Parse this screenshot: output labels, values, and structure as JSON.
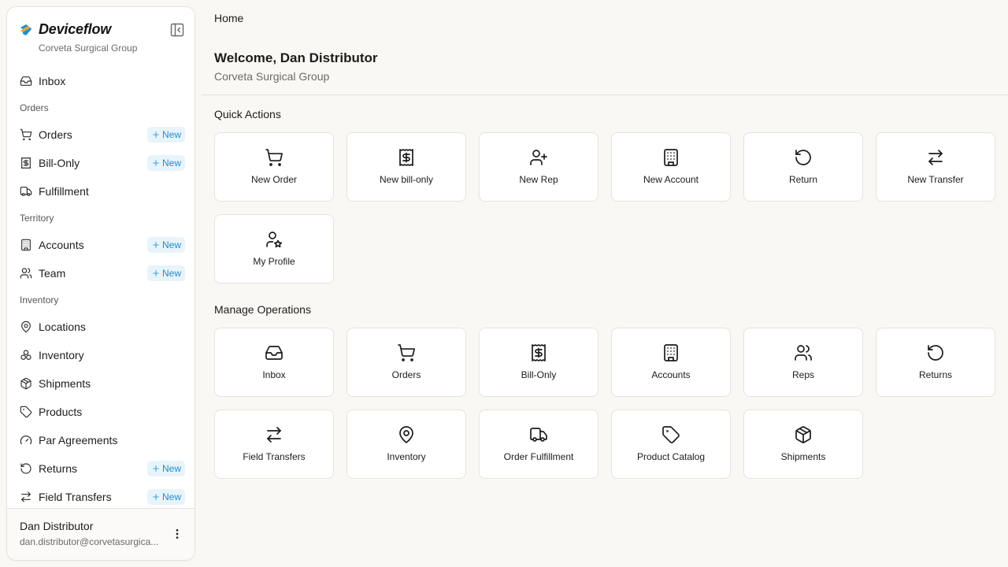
{
  "brand": {
    "name": "Deviceflow",
    "org": "Corveta Surgical Group"
  },
  "colors": {
    "accent": "#1a8fd0",
    "badge_bg": "#e8f4fb",
    "background": "#faf8f5",
    "border": "#e6e3de"
  },
  "sidebar": {
    "inbox": {
      "label": "Inbox",
      "icon": "inbox-icon"
    },
    "sections": {
      "orders": "Orders",
      "territory": "Territory",
      "inventory": "Inventory"
    },
    "items": {
      "orders": {
        "label": "Orders",
        "icon": "cart-icon",
        "badge": "New"
      },
      "bill_only": {
        "label": "Bill-Only",
        "icon": "receipt-icon",
        "badge": "New"
      },
      "fulfillment": {
        "label": "Fulfillment",
        "icon": "truck-icon"
      },
      "accounts": {
        "label": "Accounts",
        "icon": "building-icon",
        "badge": "New"
      },
      "team": {
        "label": "Team",
        "icon": "users-icon",
        "badge": "New"
      },
      "locations": {
        "label": "Locations",
        "icon": "map-pin-icon"
      },
      "inventory": {
        "label": "Inventory",
        "icon": "boxes-icon"
      },
      "shipments": {
        "label": "Shipments",
        "icon": "package-icon"
      },
      "products": {
        "label": "Products",
        "icon": "tag-icon"
      },
      "par_agreements": {
        "label": "Par Agreements",
        "icon": "gauge-icon"
      },
      "returns": {
        "label": "Returns",
        "icon": "rotate-ccw-icon",
        "badge": "New"
      },
      "field_transfers": {
        "label": "Field Transfers",
        "icon": "arrows-exchange-icon",
        "badge": "New"
      }
    },
    "user": {
      "name": "Dan Distributor",
      "email": "dan.distributor@corvetasurgica..."
    }
  },
  "header": {
    "breadcrumb": "Home"
  },
  "main": {
    "title": "Welcome, Dan Distributor",
    "subtitle": "Corveta Surgical Group",
    "quick_actions": {
      "title": "Quick Actions",
      "items": [
        {
          "label": "New Order",
          "icon": "cart-icon"
        },
        {
          "label": "New bill-only",
          "icon": "receipt-icon"
        },
        {
          "label": "New Rep",
          "icon": "user-plus-icon"
        },
        {
          "label": "New Account",
          "icon": "building-icon"
        },
        {
          "label": "Return",
          "icon": "rotate-ccw-icon"
        },
        {
          "label": "New Transfer",
          "icon": "arrows-exchange-icon"
        },
        {
          "label": "My Profile",
          "icon": "user-star-icon"
        }
      ]
    },
    "manage_operations": {
      "title": "Manage Operations",
      "items": [
        {
          "label": "Inbox",
          "icon": "inbox-icon"
        },
        {
          "label": "Orders",
          "icon": "cart-icon"
        },
        {
          "label": "Bill-Only",
          "icon": "receipt-icon"
        },
        {
          "label": "Accounts",
          "icon": "building-icon"
        },
        {
          "label": "Reps",
          "icon": "users-icon"
        },
        {
          "label": "Returns",
          "icon": "rotate-ccw-icon"
        },
        {
          "label": "Field Transfers",
          "icon": "arrows-exchange-icon"
        },
        {
          "label": "Inventory",
          "icon": "map-pin-icon"
        },
        {
          "label": "Order Fulfillment",
          "icon": "truck-icon"
        },
        {
          "label": "Product Catalog",
          "icon": "tag-icon"
        },
        {
          "label": "Shipments",
          "icon": "package-icon"
        }
      ]
    }
  }
}
